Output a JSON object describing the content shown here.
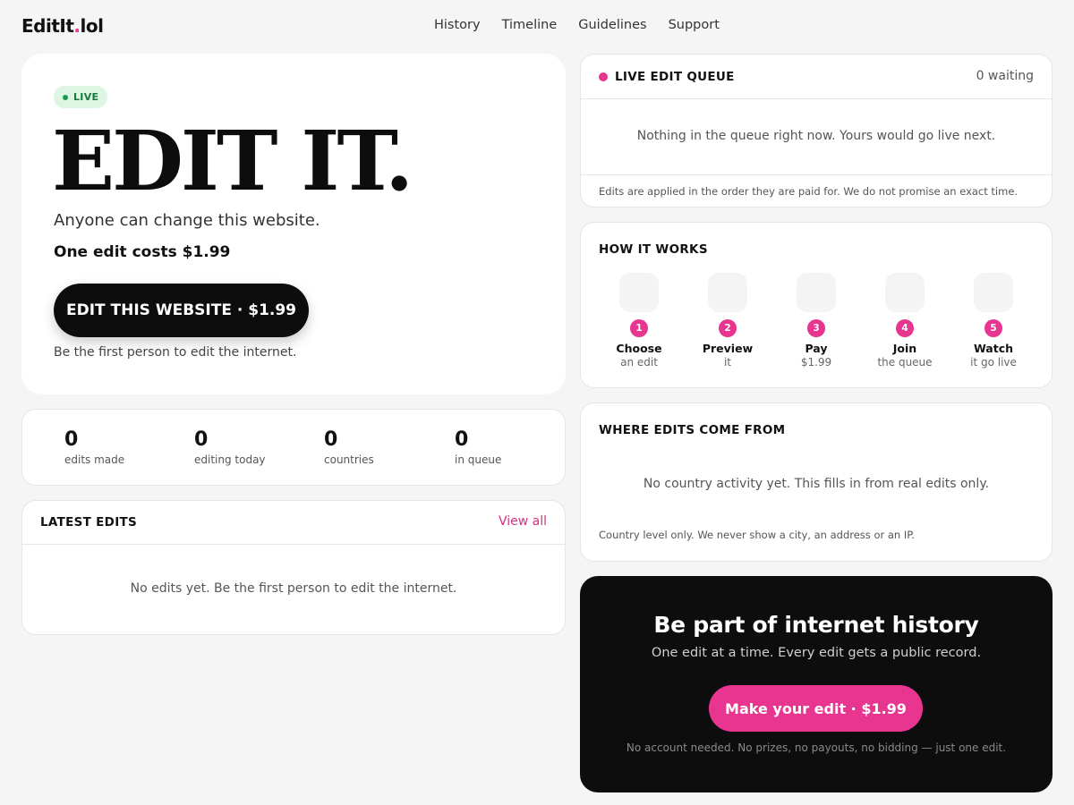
{
  "header": {
    "logo_main": "EditIt",
    "logo_dot": ".",
    "logo_tld": "lol",
    "nav": [
      "History",
      "Timeline",
      "Guidelines",
      "Support"
    ]
  },
  "hero": {
    "badge": "LIVE",
    "title": "EDIT IT.",
    "subtitle": "Anyone can change this website.",
    "price": "One edit costs $1.99",
    "cta": "EDIT THIS WEBSITE · $1.99",
    "note": "Be the first person to edit the internet."
  },
  "stats": [
    {
      "value": "0",
      "label": "edits made"
    },
    {
      "value": "0",
      "label": "editing today"
    },
    {
      "value": "0",
      "label": "countries"
    },
    {
      "value": "0",
      "label": "in queue"
    }
  ],
  "latest": {
    "title": "LATEST EDITS",
    "view_all": "View all",
    "empty": "No edits yet. Be the first person to edit the internet."
  },
  "queue": {
    "title": "LIVE EDIT QUEUE",
    "waiting": "0 waiting",
    "empty": "Nothing in the queue right now. Yours would go live next.",
    "footer": "Edits are applied in the order they are paid for. We do not promise an exact time."
  },
  "how": {
    "title": "HOW IT WORKS",
    "steps": [
      {
        "n": "1",
        "title": "Choose",
        "sub": "an edit"
      },
      {
        "n": "2",
        "title": "Preview",
        "sub": "it"
      },
      {
        "n": "3",
        "title": "Pay",
        "sub": "$1.99"
      },
      {
        "n": "4",
        "title": "Join",
        "sub": "the queue"
      },
      {
        "n": "5",
        "title": "Watch",
        "sub": "it go live"
      }
    ]
  },
  "where": {
    "title": "WHERE EDITS COME FROM",
    "empty": "No country activity yet. This fills in from real edits only.",
    "footer": "Country level only. We never show a city, an address or an IP."
  },
  "cta": {
    "title": "Be part of internet history",
    "subtitle": "One edit at a time. Every edit gets a public record.",
    "button": "Make your edit · $1.99",
    "footer": "No account needed. No prizes, no payouts, no bidding — just one edit."
  },
  "colors": {
    "accent": "#e8358f",
    "live_green": "#1f9a4c",
    "dark": "#0d0d0d",
    "background": "#f5f5f5"
  }
}
